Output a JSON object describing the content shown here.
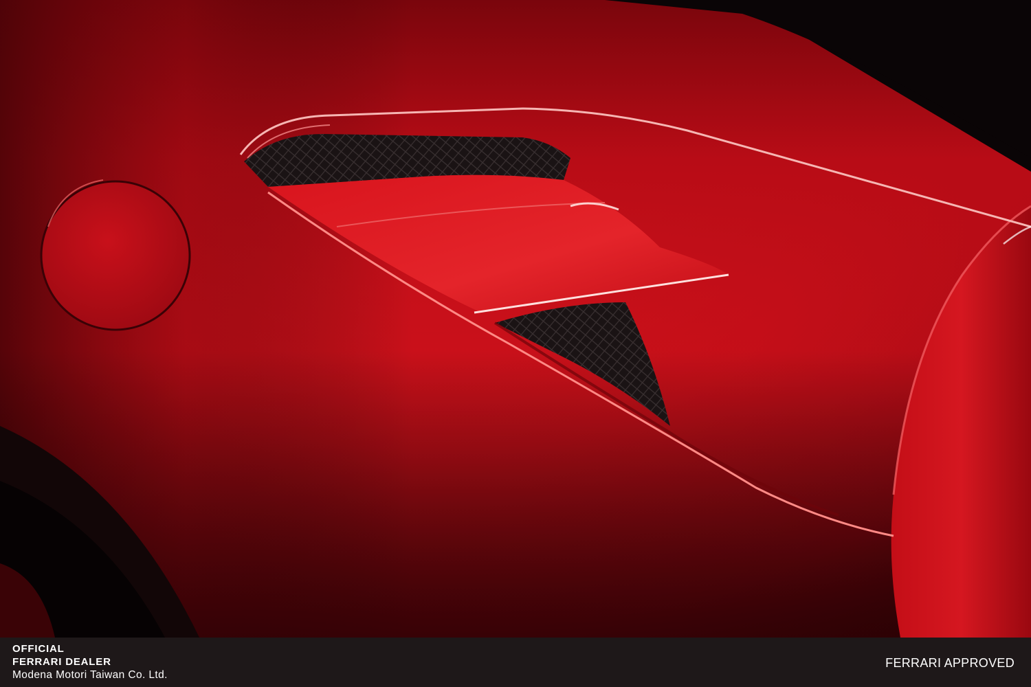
{
  "photo": {
    "subject": "red car rear fender with side air intake and fuel cap",
    "colors": {
      "body_red": "#d0121c",
      "highlight_red": "#ee2a30",
      "shadow_red": "#5a0308",
      "background": "#0a0506",
      "mesh": "#231c1d",
      "footer": "#1e1819"
    },
    "icons": [
      "fuel-cap-icon",
      "air-intake-mesh-icon"
    ]
  },
  "footer": {
    "official": "OFFICIAL",
    "dealer": "FERRARI DEALER",
    "company": "Modena Motori Taiwan Co. Ltd.",
    "approved": "FERRARI APPROVED"
  }
}
